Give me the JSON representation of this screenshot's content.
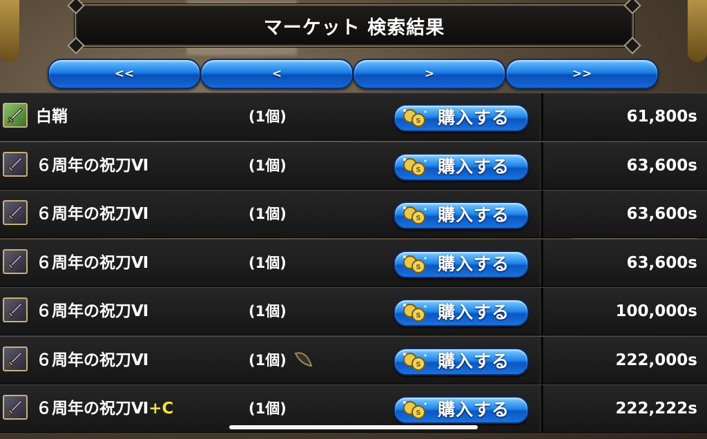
{
  "header": {
    "title": "マーケット 検索結果"
  },
  "nav": {
    "first": "<<",
    "prev": "<",
    "next": ">",
    "last": ">>"
  },
  "buy_label": "購入する",
  "items": [
    {
      "name": "白鞘",
      "suffix": "",
      "qty": "(1個)",
      "price": "61,800s",
      "icon": "green-sword-icon",
      "seed": false
    },
    {
      "name": "６周年の祝刀Ⅵ",
      "suffix": "",
      "qty": "(1個)",
      "price": "63,600s",
      "icon": "purple-sword-icon",
      "seed": false
    },
    {
      "name": "６周年の祝刀Ⅵ",
      "suffix": "",
      "qty": "(1個)",
      "price": "63,600s",
      "icon": "purple-sword-icon",
      "seed": false
    },
    {
      "name": "６周年の祝刀Ⅵ",
      "suffix": "",
      "qty": "(1個)",
      "price": "63,600s",
      "icon": "purple-sword-icon",
      "seed": false
    },
    {
      "name": "６周年の祝刀Ⅵ",
      "suffix": "",
      "qty": "(1個)",
      "price": "100,000s",
      "icon": "purple-sword-icon",
      "seed": false
    },
    {
      "name": "６周年の祝刀Ⅵ",
      "suffix": "",
      "qty": "(1個)",
      "price": "222,000s",
      "icon": "purple-sword-icon",
      "seed": true
    },
    {
      "name": "６周年の祝刀Ⅵ",
      "suffix": "+C",
      "qty": "(1個)",
      "price": "222,222s",
      "icon": "purple-sword-icon",
      "seed": false
    }
  ]
}
